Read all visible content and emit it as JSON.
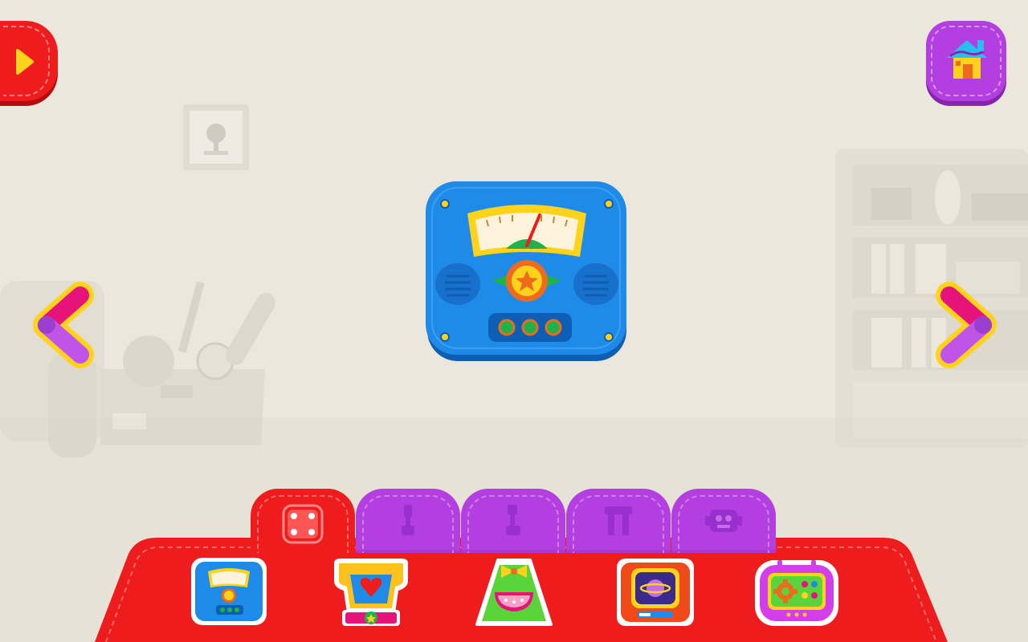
{
  "colors": {
    "panel_red": "#ee1c1c",
    "tab_purple": "#b33fe0",
    "toy_blue": "#1e8be8",
    "arrow_yellow": "#ffd21c",
    "arrow_pink": "#e6147a"
  },
  "top_bar": {
    "play_button": {
      "icon": "play-icon"
    },
    "home_button": {
      "icon": "house-icon"
    }
  },
  "navigation": {
    "prev_arrow": {
      "icon": "chevron-left-icon"
    },
    "next_arrow": {
      "icon": "chevron-right-icon"
    }
  },
  "main_display": {
    "selected_item": "radio-meter-toy"
  },
  "tabs": [
    {
      "icon": "dice-icon",
      "active": true
    },
    {
      "icon": "robot-arm-icon",
      "active": false
    },
    {
      "icon": "robot-leg-icon",
      "active": false
    },
    {
      "icon": "robot-legs-icon",
      "active": false
    },
    {
      "icon": "robot-head-icon",
      "active": false
    }
  ],
  "items": [
    {
      "icon": "meter-panel-icon",
      "selected": true
    },
    {
      "icon": "heart-torso-icon",
      "selected": false
    },
    {
      "icon": "bow-dress-icon",
      "selected": false
    },
    {
      "icon": "planet-tv-icon",
      "selected": false
    },
    {
      "icon": "gear-screen-icon",
      "selected": false
    }
  ]
}
